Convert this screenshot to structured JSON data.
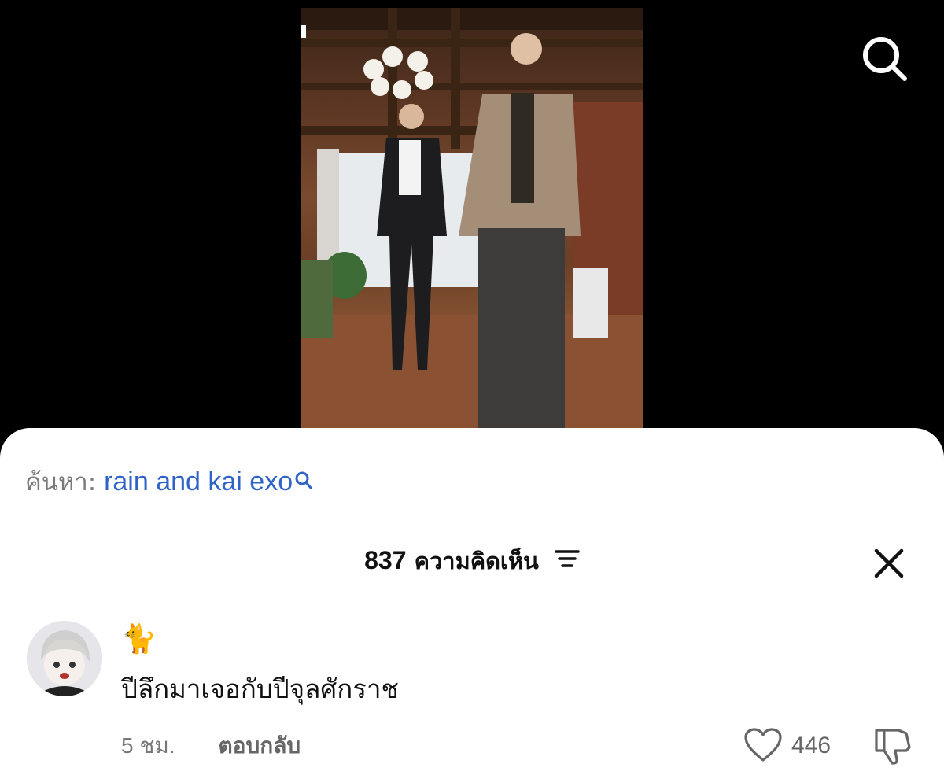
{
  "top_bar": {
    "search_icon": "search-icon"
  },
  "video": {
    "description": ""
  },
  "sheet": {
    "search_label": "ค้นหา:",
    "search_query": "rain and kai exo",
    "search_query_icon": "search-icon",
    "comments_count": "837",
    "comments_label": "ความคิดเห็น",
    "sort_icon": "sort-icon",
    "close_icon": "close-icon"
  },
  "comment": {
    "author_name": "🐈",
    "text": "ปีลึกมาเจอกับปีจุลศักราช",
    "time": "5 ชม.",
    "reply_label": "ตอบกลับ",
    "like_count": "446",
    "like_icon": "heart-icon",
    "dislike_icon": "thumbs-down-icon"
  },
  "colors": {
    "link_blue": "#2f63c8",
    "muted_gray": "#7a7a7a",
    "background_dark": "#000000",
    "sheet_bg": "#ffffff"
  }
}
